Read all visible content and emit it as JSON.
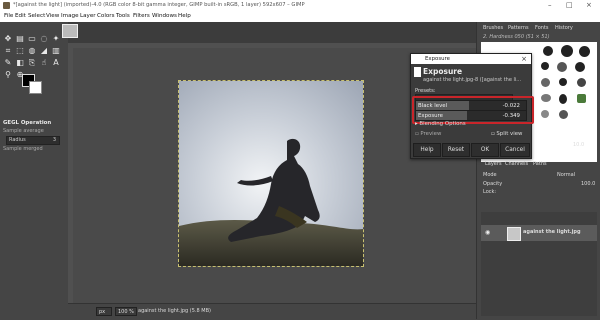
{
  "window": {
    "title": "*[against the light] (imported)-4.0 (RGB color 8-bit gamma integer, GIMP built-in sRGB, 1 layer) 592x607 – GIMP",
    "controls": [
      "–",
      "□",
      "×"
    ]
  },
  "menubar": {
    "items": [
      "File",
      "Edit",
      "Select",
      "View",
      "Image",
      "Layer",
      "Colors",
      "Tools",
      "Filters",
      "Windows",
      "Help"
    ]
  },
  "toolbox": {
    "gegl_label": "GEGL Operation",
    "sample_average": "Sample average",
    "radius_label": "Radius",
    "radius_value": "3",
    "sample_merged": "Sample merged"
  },
  "statusbar": {
    "unit": "px",
    "zoom": "100 %",
    "file_info": "against the light.jpg (5.8 MB)"
  },
  "dialog": {
    "window_title": "Exposure",
    "heading": "Exposure",
    "subtitle": "against the light.jpg-8 ([against the li...",
    "presets_label": "Presets:",
    "black_level_label": "Black level",
    "black_level_value": "-0.022",
    "black_level_fraction": 0.48,
    "exposure_label": "Exposure",
    "exposure_value": "-0.349",
    "exposure_fraction": 0.46,
    "blending_label": "Blending Options",
    "preview_label": "Preview",
    "split_label": "Split view",
    "buttons": {
      "help": "Help",
      "reset": "Reset",
      "ok": "OK",
      "cancel": "Cancel"
    }
  },
  "dock": {
    "brush_tabs": [
      "Brushes",
      "Patterns",
      "Fonts",
      "History"
    ],
    "brush_name": "2. Hardness 050 (51 × 51)",
    "brush_size": "10.0",
    "layer_tabs": [
      "Layers",
      "Channels",
      "Paths"
    ],
    "mode_label": "Mode",
    "mode_value": "Normal",
    "opacity_label": "Opacity",
    "opacity_value": "100.0",
    "lock_label": "Lock:",
    "layer_name": "against the light.jpg"
  }
}
